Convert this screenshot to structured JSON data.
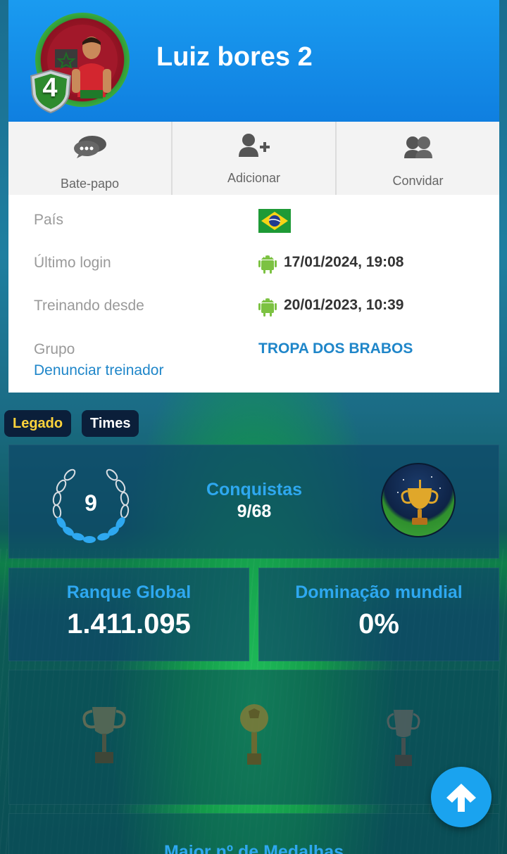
{
  "profile": {
    "name": "Luiz bores 2",
    "level": "4"
  },
  "actions": [
    {
      "label": "Bate-papo",
      "icon": "chat-icon"
    },
    {
      "label": "Adicionar",
      "icon": "add-friend-icon"
    },
    {
      "label": "Convidar",
      "icon": "invite-icon"
    }
  ],
  "info": {
    "country_label": "País",
    "country_flag": "brazil-flag",
    "last_login_label": "Último login",
    "last_login_value": "17/01/2024, 19:08",
    "training_since_label": "Treinando desde",
    "training_since_value": "20/01/2023, 10:39",
    "platform_icon": "android-icon",
    "group_label": "Grupo",
    "group_value": "TROPA DOS BRABOS",
    "report_link": "Denunciar treinador"
  },
  "tabs": {
    "legado": "Legado",
    "times": "Times"
  },
  "achievements": {
    "laurel_value": "9",
    "title": "Conquistas",
    "count": "9/68"
  },
  "stats": {
    "global_rank_label": "Ranque Global",
    "global_rank_value": "1.411.095",
    "world_domination_label": "Dominação mundial",
    "world_domination_value": "0%"
  },
  "medals": {
    "title": "Maior nº de Medalhas"
  },
  "colors": {
    "header_blue": "#1a9bf0",
    "link_blue": "#1f86c9",
    "panel_title_blue": "#2ea8f0",
    "tab_legado_yellow": "#ffd43b",
    "android_green": "#7cc242"
  }
}
